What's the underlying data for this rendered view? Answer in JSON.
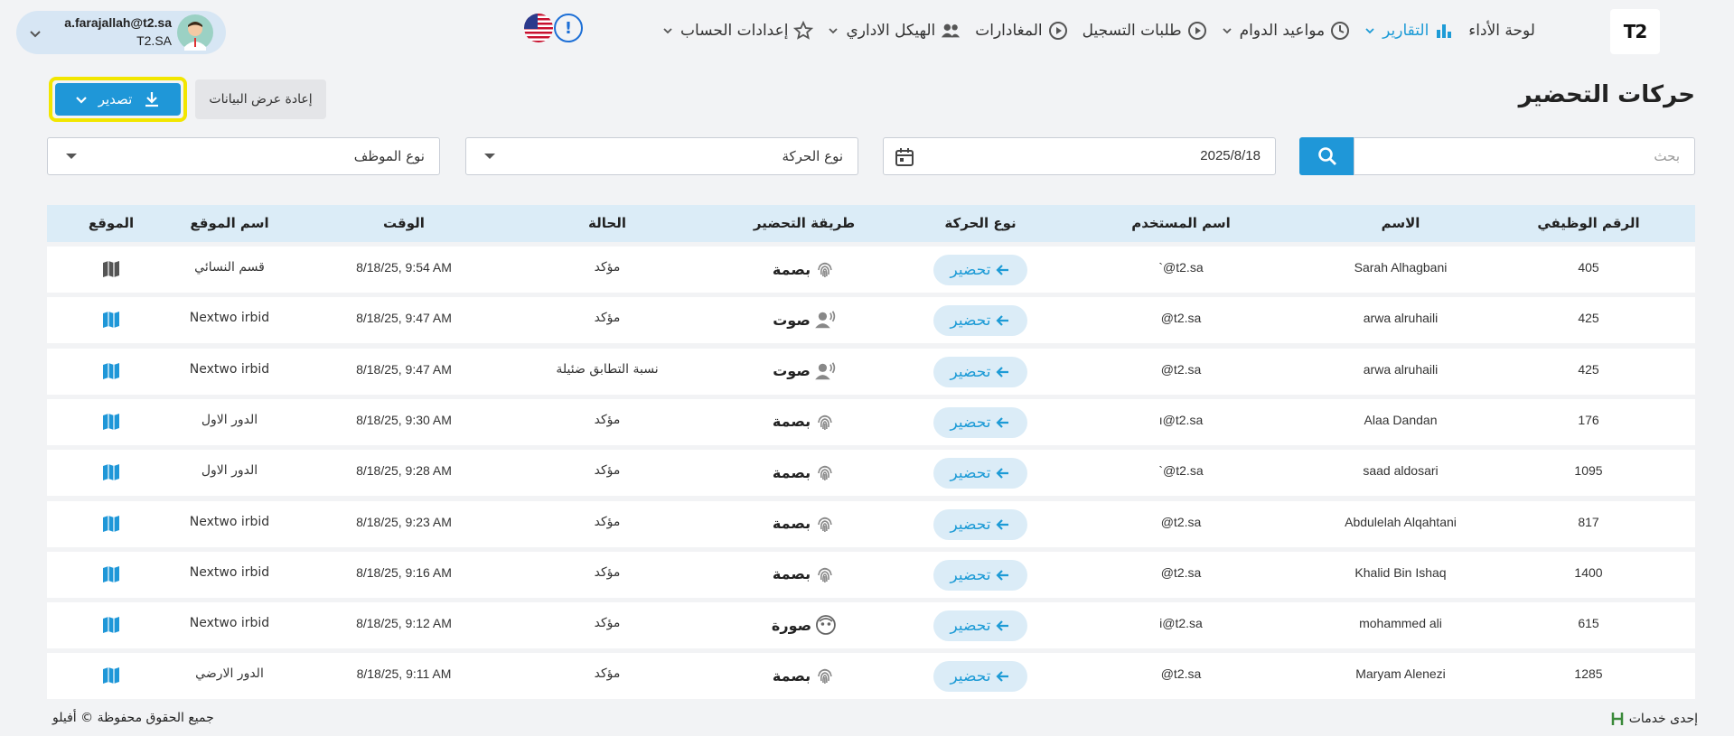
{
  "header": {
    "logo_text": "T2",
    "user_email": "a.farajallah@t2.sa",
    "user_org": "T2.SA",
    "nav": [
      {
        "label": "لوحة الأداء",
        "icon": "",
        "caret": false,
        "active": false
      },
      {
        "label": "التقارير",
        "icon": "bar-chart-icon",
        "caret": true,
        "active": true
      },
      {
        "label": "مواعيد الدوام",
        "icon": "clock-icon",
        "caret": true,
        "active": false
      },
      {
        "label": "طلبات التسجيل",
        "icon": "play-circle-icon",
        "caret": false,
        "active": false
      },
      {
        "label": "المغادارات",
        "icon": "play-circle-icon",
        "caret": false,
        "active": false
      },
      {
        "label": "الهيكل الاداري",
        "icon": "people-icon",
        "caret": true,
        "active": false
      },
      {
        "label": "إعدادات الحساب",
        "icon": "star-icon",
        "caret": true,
        "active": false
      }
    ]
  },
  "page": {
    "title": "حركات التحضير",
    "export_label": "تصدير",
    "reset_label": "إعادة عرض البيانات"
  },
  "filters": {
    "search_placeholder": "بحث",
    "date_value": "2025/8/18",
    "movement_type": "نوع الحركة",
    "employee_type": "نوع الموظف"
  },
  "table": {
    "headers": [
      "الرقم الوظيفي",
      "الاسم",
      "اسم المستخدم",
      "نوع الحركة",
      "طريقة التحضير",
      "الحالة",
      "الوقت",
      "اسم الموقع",
      "الموقع"
    ],
    "rows": [
      {
        "id": "405",
        "name": "Sarah Alhagbani",
        "username": "`@t2.sa",
        "movement": "تحضير",
        "method": "بصمة",
        "method_icon": "fingerprint-icon",
        "status": "مؤكد",
        "time": "8/18/25, 9:54 AM",
        "location": "قسم النسائي",
        "map_color": "#555555"
      },
      {
        "id": "425",
        "name": "arwa alruhaili",
        "username": "@t2.sa",
        "movement": "تحضير",
        "method": "صوت",
        "method_icon": "voice-icon",
        "status": "مؤكد",
        "time": "8/18/25, 9:47 AM",
        "location": "Nextwo irbid",
        "map_color": "#1f97d8"
      },
      {
        "id": "425",
        "name": "arwa alruhaili",
        "username": "@t2.sa",
        "movement": "تحضير",
        "method": "صوت",
        "method_icon": "voice-icon",
        "status": "نسبة التطابق ضئيلة",
        "time": "8/18/25, 9:47 AM",
        "location": "Nextwo irbid",
        "map_color": "#1f97d8"
      },
      {
        "id": "176",
        "name": "Alaa Dandan",
        "username": "ı@t2.sa",
        "movement": "تحضير",
        "method": "بصمة",
        "method_icon": "fingerprint-icon",
        "status": "مؤكد",
        "time": "8/18/25, 9:30 AM",
        "location": "الدور الاول",
        "map_color": "#1f97d8"
      },
      {
        "id": "1095",
        "name": "saad aldosari",
        "username": "`@t2.sa",
        "movement": "تحضير",
        "method": "بصمة",
        "method_icon": "fingerprint-icon",
        "status": "مؤكد",
        "time": "8/18/25, 9:28 AM",
        "location": "الدور الاول",
        "map_color": "#1f97d8"
      },
      {
        "id": "817",
        "name": "Abdulelah Alqahtani",
        "username": "@t2.sa",
        "movement": "تحضير",
        "method": "بصمة",
        "method_icon": "fingerprint-icon",
        "status": "مؤكد",
        "time": "8/18/25, 9:23 AM",
        "location": "Nextwo irbid",
        "map_color": "#1f97d8"
      },
      {
        "id": "1400",
        "name": "Khalid Bin Ishaq",
        "username": "@t2.sa",
        "movement": "تحضير",
        "method": "بصمة",
        "method_icon": "fingerprint-icon",
        "status": "مؤكد",
        "time": "8/18/25, 9:16 AM",
        "location": "Nextwo irbid",
        "map_color": "#1f97d8"
      },
      {
        "id": "615",
        "name": "mohammed ali",
        "username": "i@t2.sa",
        "movement": "تحضير",
        "method": "صورة",
        "method_icon": "face-icon",
        "status": "مؤكد",
        "time": "8/18/25, 9:12 AM",
        "location": "Nextwo irbid",
        "map_color": "#1f97d8"
      },
      {
        "id": "1285",
        "name": "Maryam Alenezi",
        "username": "@t2.sa",
        "movement": "تحضير",
        "method": "بصمة",
        "method_icon": "fingerprint-icon",
        "status": "مؤكد",
        "time": "8/18/25, 9:11 AM",
        "location": "الدور الارضي",
        "map_color": "#1f97d8"
      }
    ]
  },
  "footer": {
    "copyright": "جميع الحقوق محفوظة © أفيلو",
    "service": "إحدى خدمات"
  },
  "colors": {
    "accent": "#1f97d8",
    "highlight": "#f2e600",
    "header_bg": "#dbecf7"
  }
}
